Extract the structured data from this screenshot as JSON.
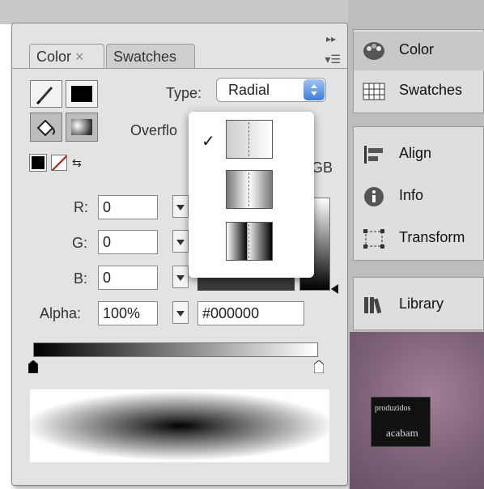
{
  "color_panel": {
    "tabs": [
      {
        "label": "Color",
        "close": "×"
      },
      {
        "label": "Swatches"
      }
    ],
    "type_label": "Type:",
    "type_value": "Radial",
    "overflow_label": "Overflo",
    "overflow_menu_checkmark": "✓",
    "rgb_fragment": "GB",
    "r_label": "R:",
    "r_value": "0",
    "g_label": "G:",
    "g_value": "0",
    "b_label": "B:",
    "b_value": "0",
    "alpha_label": "Alpha:",
    "alpha_value": "100%",
    "hex_value": "#000000",
    "colors": {
      "stroke_swatch": "#000000",
      "fill_swatch": "#000000"
    }
  },
  "dock": {
    "group1": [
      "Color",
      "Swatches"
    ],
    "group2": [
      "Align",
      "Info",
      "Transform"
    ],
    "group3": [
      "Library"
    ],
    "stage_thumbnail_text": [
      "produzidos",
      "acabam"
    ]
  }
}
